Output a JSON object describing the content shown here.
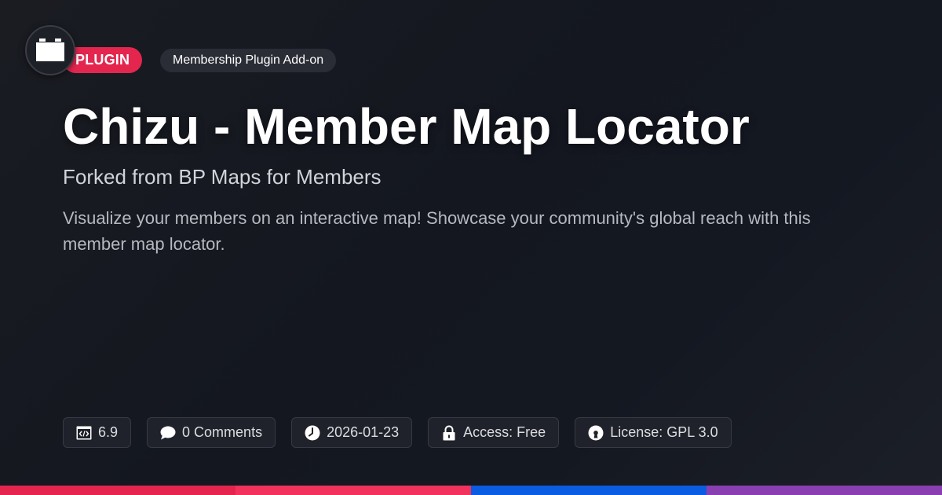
{
  "badge": {
    "type_label": "PLUGIN",
    "category_label": "Membership Plugin Add-on"
  },
  "logo": {
    "icon": "plugin-block-icon"
  },
  "title": "Chizu - Member Map Locator",
  "subtitle": "Forked from BP Maps for Members",
  "description": "Visualize your members on an interactive map! Showcase your community's global reach with this member map locator.",
  "meta": {
    "version": {
      "icon": "code-window-icon",
      "text": "6.9"
    },
    "comments": {
      "icon": "speech-bubble-icon",
      "text": "0 Comments"
    },
    "date": {
      "icon": "clock-icon",
      "text": "2026-01-23"
    },
    "access": {
      "icon": "lock-icon",
      "text": "Access: Free"
    },
    "license": {
      "icon": "open-source-icon",
      "text": "License: GPL 3.0"
    }
  },
  "colors": {
    "accent": "#e4264f",
    "bar": [
      "#e4264f",
      "#f0325c",
      "#0a5ce0",
      "#8a3fb0"
    ]
  }
}
